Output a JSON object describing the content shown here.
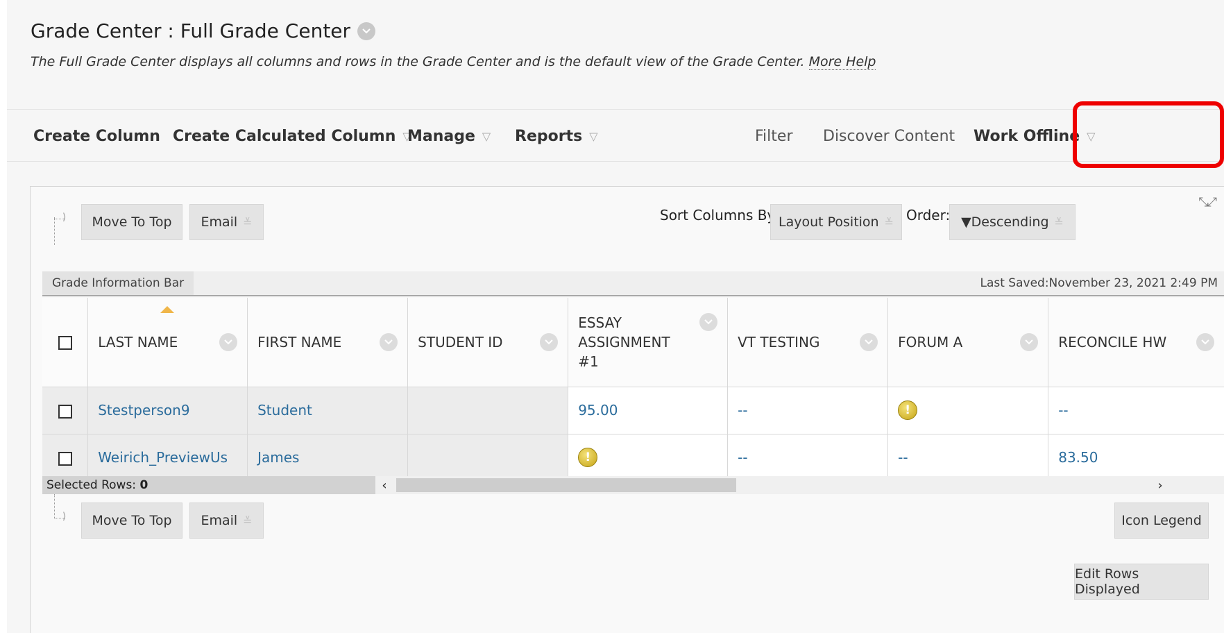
{
  "header": {
    "title": "Grade Center : Full Grade Center",
    "description": "The Full Grade Center displays all columns and rows in the Grade Center and is the default view of the Grade Center.",
    "more_help": "More Help"
  },
  "actionbar": {
    "create_column": "Create Column",
    "create_calculated_column": "Create Calculated Column",
    "manage": "Manage",
    "reports": "Reports",
    "filter": "Filter",
    "discover_content": "Discover Content",
    "work_offline": "Work Offline"
  },
  "toolbar": {
    "move_to_top": "Move To Top",
    "email": "Email",
    "sort_columns_by": "Sort Columns By:",
    "sort_value": "Layout Position",
    "order_label": "Order:",
    "order_value": "▼Descending"
  },
  "infobar": {
    "tab": "Grade Information Bar",
    "last_saved": "Last Saved:November 23, 2021 2:49 PM"
  },
  "table": {
    "columns": [
      "LAST NAME",
      "FIRST NAME",
      "STUDENT ID",
      "ESSAY ASSIGNMENT #1",
      "VT TESTING",
      "FORUM A",
      "RECONCILE HW"
    ],
    "rows": [
      {
        "last": "Stestperson9",
        "first": "Student",
        "id": "",
        "essay": "95.00",
        "vt": "--",
        "forum": "!",
        "reconcile": "--"
      },
      {
        "last": "Weirich_PreviewUs",
        "first": "James",
        "id": "",
        "essay": "!",
        "vt": "--",
        "forum": "--",
        "reconcile": "83.50"
      }
    ]
  },
  "footer": {
    "selected_rows_label": "Selected Rows:",
    "selected_rows_count": "0",
    "icon_legend": "Icon Legend",
    "edit_rows_displayed": "Edit Rows Displayed"
  },
  "colors": {
    "highlight": "#ee0000",
    "arrow": "#5b9bd5",
    "link": "#2b6c9c"
  }
}
